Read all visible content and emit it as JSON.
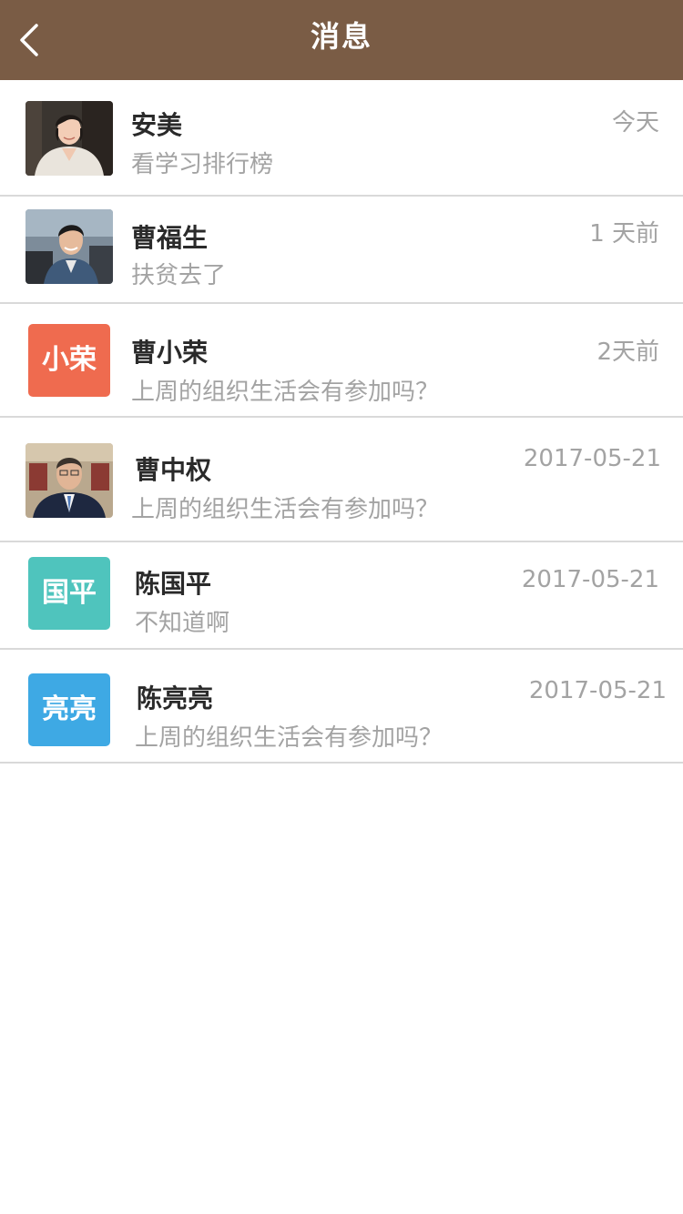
{
  "header": {
    "title": "消息",
    "back_icon": "chevron-left-icon",
    "background": "#7a5c45"
  },
  "messages": [
    {
      "name": "安美",
      "preview": "看学习排行榜",
      "time": "今天",
      "avatar": {
        "kind": "photo",
        "description_icon": "photo-avatar-woman"
      }
    },
    {
      "name": "曹福生",
      "preview": "扶贫去了",
      "time": "1 天前",
      "avatar": {
        "kind": "photo",
        "description_icon": "photo-avatar-man"
      }
    },
    {
      "name": "曹小荣",
      "preview": "上周的组织生活会有参加吗？",
      "time": "2天前",
      "avatar": {
        "kind": "text",
        "text": "小荣",
        "color": "#ef6b4f"
      }
    },
    {
      "name": "曹中权",
      "preview": "上周的组织生活会有参加吗？",
      "time": "2017-05-21",
      "avatar": {
        "kind": "photo",
        "description_icon": "photo-avatar-man-suit"
      }
    },
    {
      "name": "陈国平",
      "preview": "不知道啊",
      "time": "2017-05-21",
      "avatar": {
        "kind": "text",
        "text": "国平",
        "color": "#4fc4bd"
      }
    },
    {
      "name": "陈亮亮",
      "preview": "上周的组织生活会有参加吗？",
      "time": "2017-05-21",
      "avatar": {
        "kind": "text",
        "text": "亮亮",
        "color": "#3ea9e4"
      }
    }
  ]
}
